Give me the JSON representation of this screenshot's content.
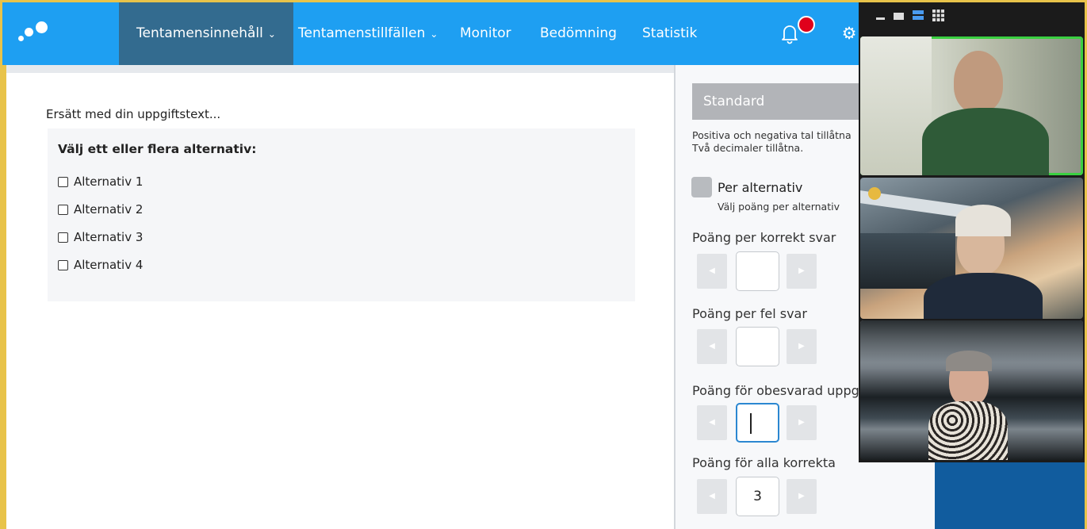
{
  "nav": {
    "items": [
      {
        "label": "Tentamensinnehåll",
        "chevron": "⌄",
        "active": true
      },
      {
        "label": "Tentamenstillfällen",
        "chevron": "⌄",
        "active": false
      },
      {
        "label": "Monitor"
      },
      {
        "label": "Bedömning"
      },
      {
        "label": "Statistik"
      }
    ]
  },
  "question": {
    "text": "Ersätt med din uppgiftstext...",
    "instruction": "Välj ett eller flera alternativ:",
    "options": [
      "Alternativ 1",
      "Alternativ 2",
      "Alternativ 3",
      "Alternativ 4"
    ]
  },
  "scoring": {
    "preset": "Standard",
    "hint_line1": "Positiva och negativa tal tillåtna",
    "hint_line2": "Två decimaler tillåtna.",
    "per_option_label": "Per alternativ",
    "per_option_sub": "Välj poäng per alternativ",
    "correct_label": "Poäng per korrekt svar",
    "correct_value": "",
    "wrong_label": "Poäng per fel svar",
    "wrong_value": "",
    "unanswered_label": "Poäng för obesvarad uppgift",
    "unanswered_value": "",
    "all_correct_label": "Poäng för alla korrekta",
    "all_correct_value": "3"
  },
  "colors": {
    "nav_bg": "#1e9ff2",
    "nav_active": "#336b8f",
    "share_border": "#e8c34a",
    "speaking_outline": "#3ad041",
    "notification": "#e0001b"
  }
}
